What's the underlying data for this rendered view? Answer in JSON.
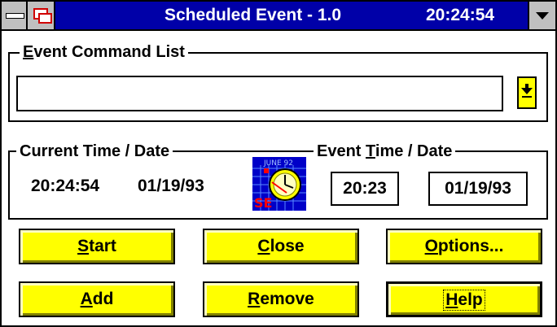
{
  "window": {
    "title": "Scheduled Event - 1.0",
    "clock": "20:24:54"
  },
  "event_command_list": {
    "label_mnemonic": "E",
    "label_rest": "vent Command List",
    "value": ""
  },
  "current": {
    "label": "Current Time / Date",
    "time": "20:24:54",
    "date": "01/19/93"
  },
  "event": {
    "label_before": "Event ",
    "label_mnemonic": "T",
    "label_after": "ime / Date",
    "time": "20:23",
    "date": "01/19/93"
  },
  "icon": {
    "name": "schedule-clock-calendar-icon",
    "calendar_text": "JUNE 92",
    "badge_text": "SE"
  },
  "buttons": {
    "start": {
      "m": "S",
      "rest": "tart"
    },
    "close": {
      "m": "C",
      "rest": "lose"
    },
    "options": {
      "m": "O",
      "rest": "ptions..."
    },
    "add": {
      "m": "A",
      "rest": "dd"
    },
    "remove": {
      "m": "R",
      "rest": "emove"
    },
    "help": {
      "m": "H",
      "rest": "elp"
    }
  },
  "colors": {
    "titlebar": "#0000a8",
    "button_face": "#ffff00"
  }
}
